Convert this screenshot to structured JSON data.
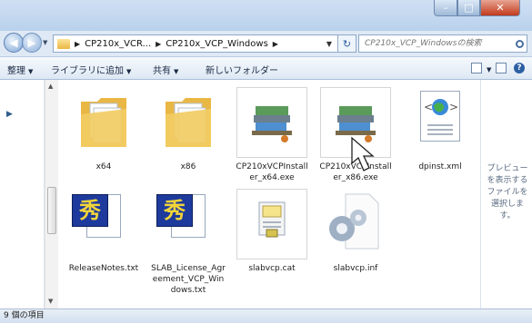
{
  "breadcrumb": {
    "items": [
      "CP210x_VCR...",
      "CP210x_VCP_Windows"
    ]
  },
  "search": {
    "placeholder": "CP210x_VCP_Windowsの検索"
  },
  "toolbar": {
    "organize": "整理",
    "add_to_library": "ライブラリに追加",
    "share": "共有",
    "new_folder": "新しいフォルダー"
  },
  "files": [
    {
      "name": "x64",
      "type": "folder"
    },
    {
      "name": "x86",
      "type": "folder"
    },
    {
      "name": "CP210xVCPInstaller_x64.exe",
      "type": "exe"
    },
    {
      "name": "CP210xVCPInstaller_x86.exe",
      "type": "exe"
    },
    {
      "name": "dpinst.xml",
      "type": "xml"
    },
    {
      "name": "ReleaseNotes.txt",
      "type": "hidemaru-txt"
    },
    {
      "name": "SLAB_License_Agreement_VCP_Windows.txt",
      "type": "hidemaru-txt"
    },
    {
      "name": "slabvcp.cat",
      "type": "cat"
    },
    {
      "name": "slabvcp.inf",
      "type": "inf"
    }
  ],
  "preview": {
    "message": "プレビューを表示するファイルを選択します。"
  },
  "status": {
    "item_count": "9 個の項目"
  },
  "colors": {
    "folder": "#f2cc63",
    "accent": "#2c5fa3",
    "close_button": "#c23a1c"
  }
}
